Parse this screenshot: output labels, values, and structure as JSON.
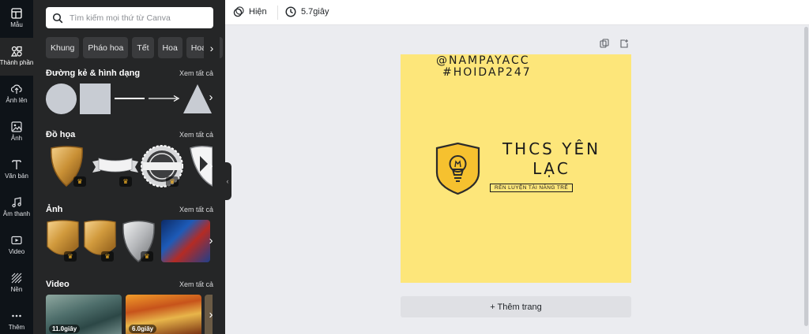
{
  "rail": [
    {
      "label": "Mẫu",
      "icon": "template-icon"
    },
    {
      "label": "Thành phần",
      "icon": "elements-icon"
    },
    {
      "label": "Ảnh lên",
      "icon": "upload-icon"
    },
    {
      "label": "Ảnh",
      "icon": "photos-icon"
    },
    {
      "label": "Văn bản",
      "icon": "text-icon"
    },
    {
      "label": "Âm thanh",
      "icon": "audio-icon"
    },
    {
      "label": "Video",
      "icon": "video-icon"
    },
    {
      "label": "Nền",
      "icon": "background-icon"
    },
    {
      "label": "Thêm",
      "icon": "more-icon"
    }
  ],
  "search": {
    "placeholder": "Tìm kiếm mọi thứ từ Canva"
  },
  "chips": [
    "Khung",
    "Pháo hoa",
    "Tết",
    "Hoa",
    "Hoa đà"
  ],
  "sections": {
    "lines": {
      "title": "Đường kẻ & hình dạng",
      "link": "Xem tất cả"
    },
    "graphics": {
      "title": "Đồ họa",
      "link": "Xem tất cả"
    },
    "photos": {
      "title": "Ảnh",
      "link": "Xem tất cả"
    },
    "videos": {
      "title": "Video",
      "link": "Xem tất cả"
    }
  },
  "videos": [
    {
      "duration": "11.0giây"
    },
    {
      "duration": "6.0giây"
    }
  ],
  "topbar": {
    "show_label": "Hiện",
    "time_label": "5.7giây"
  },
  "design": {
    "handle1": "@NAMPAYACC",
    "handle2": "#HOIDAP247",
    "title": "THCS YÊN LẠC",
    "tagline": "RÈN LUYỆN TÀI NĂNG TRẺ",
    "bg_color": "#fde67a",
    "logo_color": "#f6c12f"
  },
  "add_page_label": "+ Thêm trang",
  "colors": {
    "rail": "#0e1318",
    "panel": "#252627",
    "editor": "#ebecf0"
  }
}
